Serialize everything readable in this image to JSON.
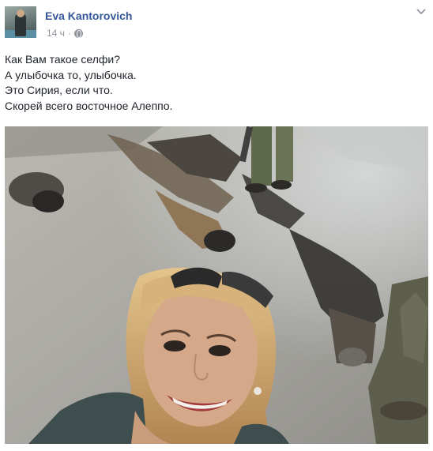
{
  "post": {
    "author": "Eva Kantorovich",
    "timestamp": "14 ч",
    "separator": "·",
    "privacy_icon": "globe-icon",
    "menu_icon": "chevron-down-icon",
    "text_lines": [
      "Как Вам такое селфи?",
      "А улыбочка то, улыбочка.",
      "Это Сирия, если что.",
      "Скорей всего восточное Алеппо."
    ]
  },
  "colors": {
    "author_link": "#365899",
    "meta_text": "#90949c",
    "body_text": "#1d2129"
  }
}
